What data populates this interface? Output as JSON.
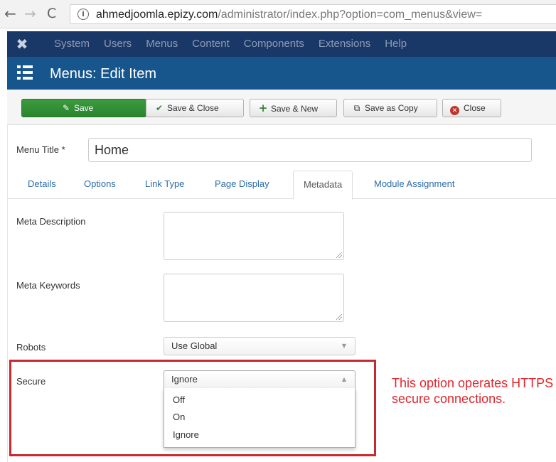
{
  "browser": {
    "back_icon": "←",
    "forward_icon": "→",
    "reload_icon": "C",
    "info_icon": "i",
    "url_host": "ahmedjoomla.epizy.com",
    "url_path": "/administrator/index.php?option=com_menus&view="
  },
  "menubar": {
    "logo_icon": "joomla-logo",
    "items": [
      "System",
      "Users",
      "Menus",
      "Content",
      "Components",
      "Extensions",
      "Help"
    ]
  },
  "page": {
    "title": "Menus: Edit Item"
  },
  "toolbar": {
    "save_label": "Save",
    "save_close_label": "Save & Close",
    "save_new_label": "Save & New",
    "save_copy_label": "Save as Copy",
    "close_label": "Close"
  },
  "menu_title": {
    "label": "Menu Title *",
    "value": "Home"
  },
  "tabs": [
    "Details",
    "Options",
    "Link Type",
    "Page Display",
    "Metadata",
    "Module Assignment"
  ],
  "active_tab": "Metadata",
  "fields": {
    "meta_description_label": "Meta Description",
    "meta_keywords_label": "Meta Keywords",
    "robots_label": "Robots",
    "robots_value": "Use Global",
    "secure_label": "Secure",
    "secure_value": "Ignore",
    "secure_options": [
      "Off",
      "On",
      "Ignore"
    ]
  },
  "annotation": {
    "text": "This option operates HTTPS secure connections.",
    "color": "#e0262e"
  },
  "colors": {
    "menubar": "#1a3867",
    "titlebar": "#17568c",
    "save_button": "#2f8a34",
    "highlight": "#c8282e"
  }
}
